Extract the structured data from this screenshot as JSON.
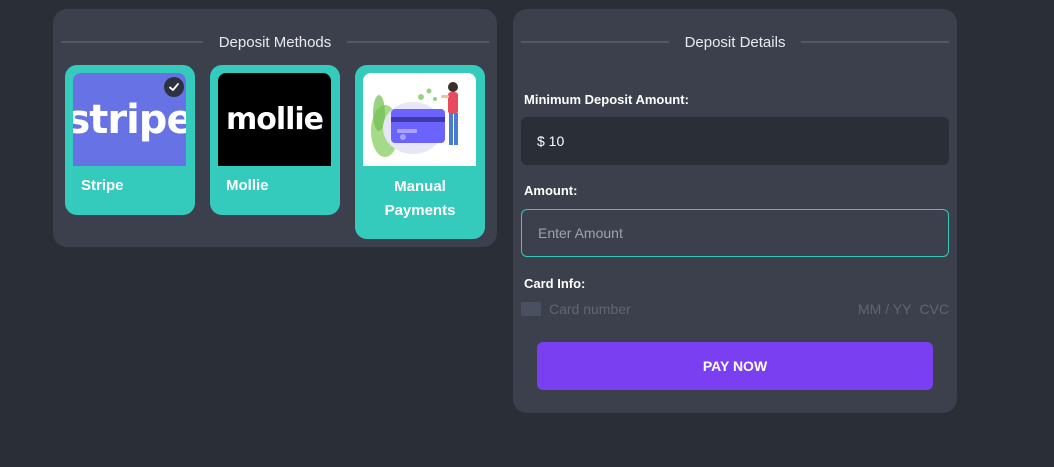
{
  "deposit_methods": {
    "title": "Deposit Methods",
    "methods": [
      {
        "label": "Stripe",
        "logo_text": "stripe",
        "selected": true,
        "logo_bg": "#6772e5"
      },
      {
        "label": "Mollie",
        "logo_text": "mollie",
        "selected": false,
        "logo_bg": "#000000"
      },
      {
        "label": "Manual Payments",
        "selected": false
      }
    ],
    "tile_color": "#34cbbd"
  },
  "deposit_details": {
    "title": "Deposit Details",
    "min_label": "Minimum Deposit Amount:",
    "min_value": "$ 10",
    "amount_label": "Amount:",
    "amount_placeholder": "Enter Amount",
    "amount_value": "",
    "card_label": "Card Info:",
    "card_number_placeholder": "Card number",
    "card_expiry_placeholder": "MM / YY",
    "card_cvc_placeholder": "CVC",
    "pay_label": "PAY NOW",
    "pay_color": "#7b3ff2"
  }
}
